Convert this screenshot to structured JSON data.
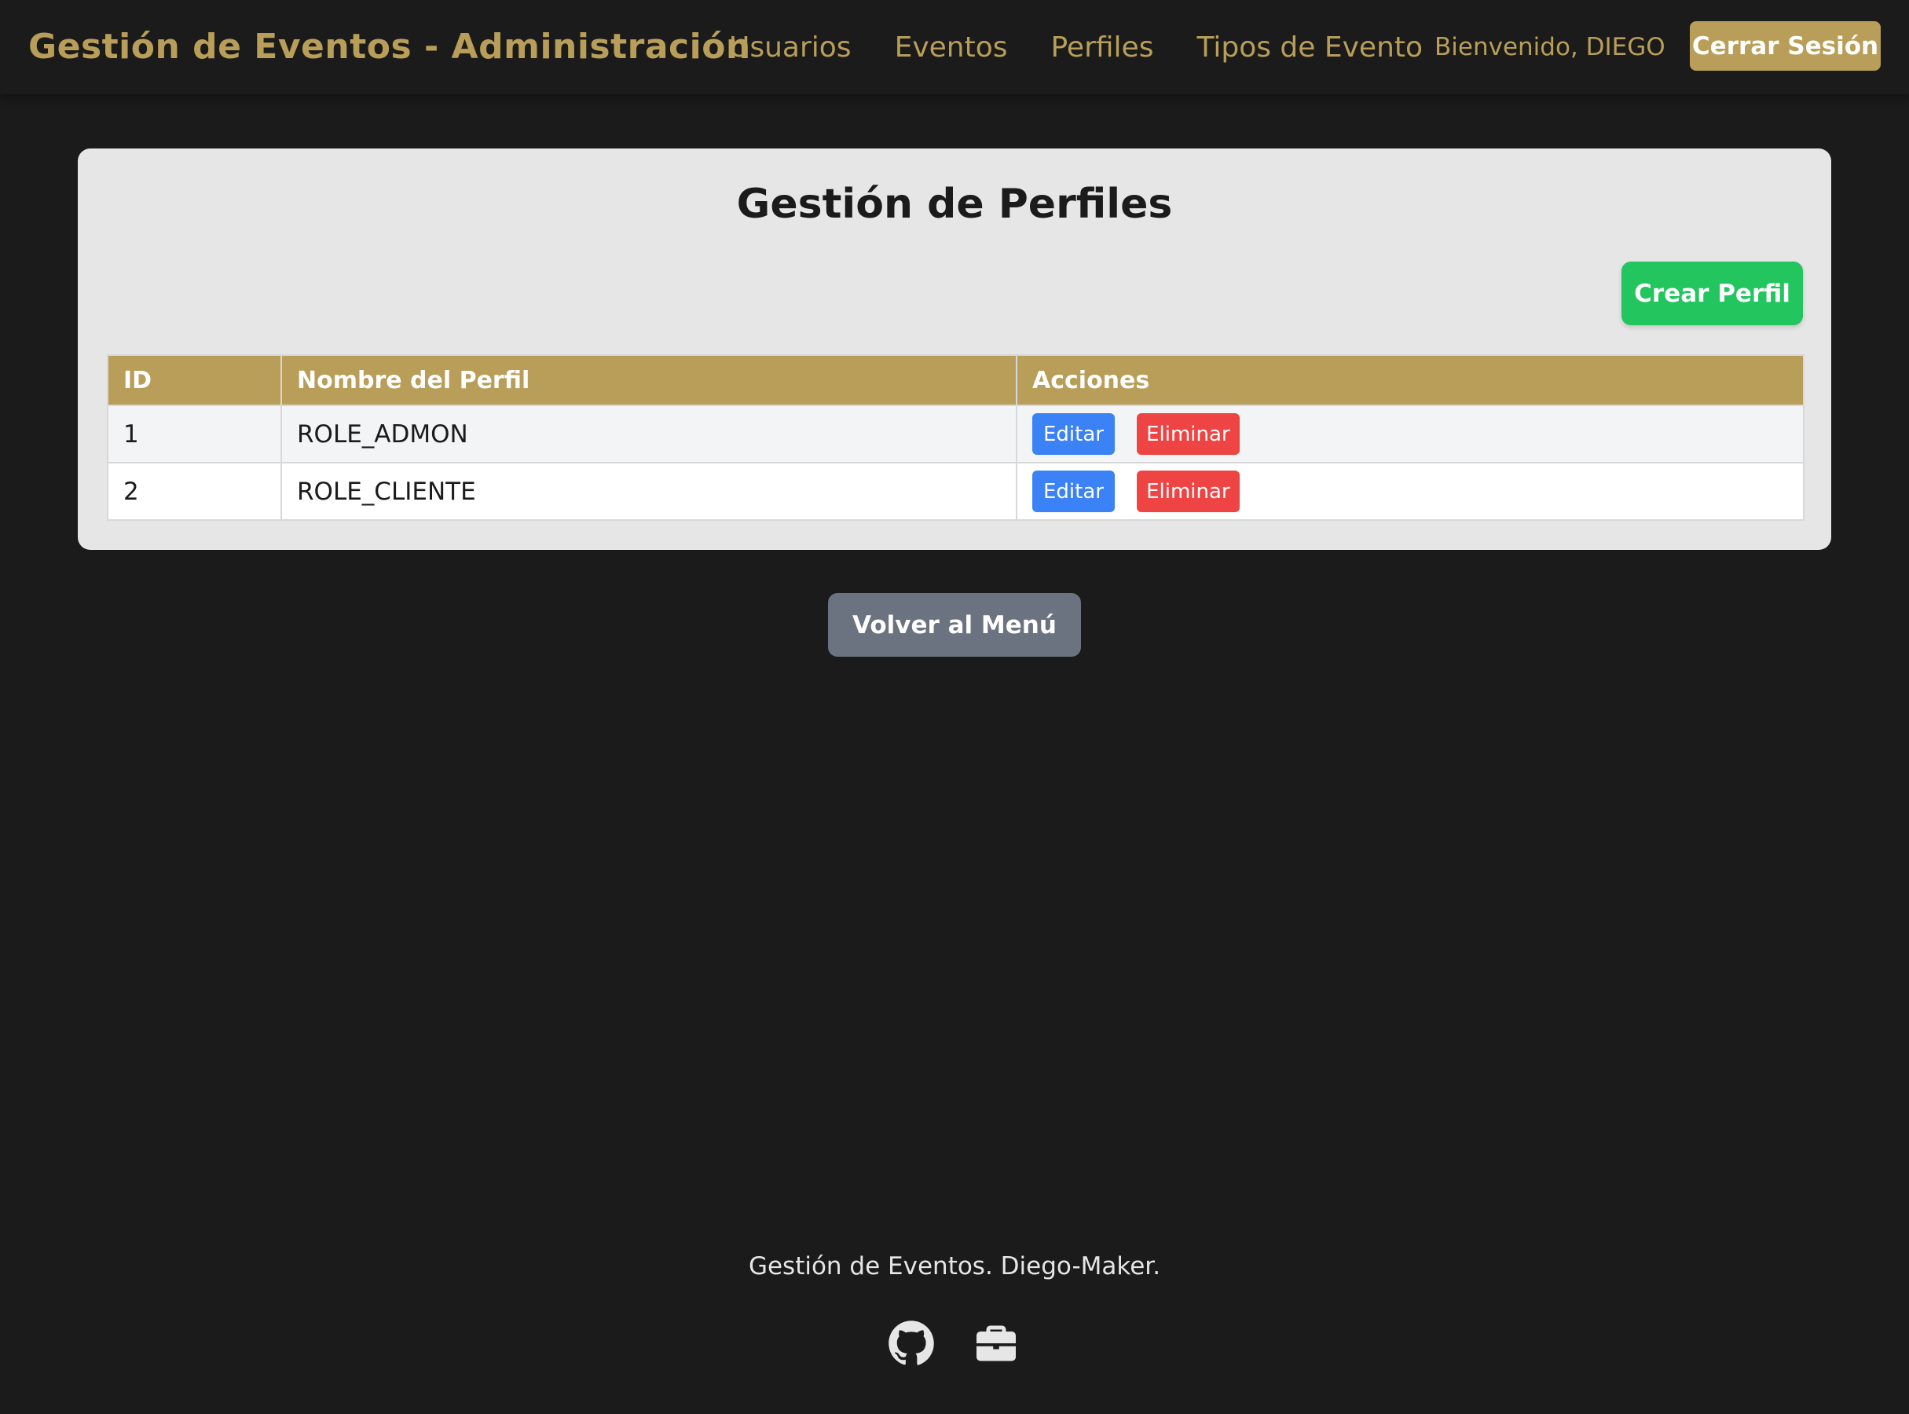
{
  "header": {
    "brand": "Gestión de Eventos - Administración",
    "nav": [
      {
        "label": "Usuarios"
      },
      {
        "label": "Eventos"
      },
      {
        "label": "Perfiles"
      },
      {
        "label": "Tipos de Evento"
      }
    ],
    "welcome": "Bienvenido, DIEGO",
    "separator": "|",
    "logout_label": "Cerrar Sesión"
  },
  "main": {
    "title": "Gestión de Perfiles",
    "create_label": "Crear Perfil",
    "table": {
      "columns": [
        "ID",
        "Nombre del Perfil",
        "Acciones"
      ],
      "rows": [
        {
          "id": "1",
          "name": "ROLE_ADMON",
          "edit": "Editar",
          "delete": "Eliminar"
        },
        {
          "id": "2",
          "name": "ROLE_CLIENTE",
          "edit": "Editar",
          "delete": "Eliminar"
        }
      ]
    },
    "back_label": "Volver al Menú"
  },
  "footer": {
    "text": "Gestión de Eventos. Diego-Maker.",
    "icons": [
      "github-icon",
      "briefcase-icon"
    ]
  },
  "colors": {
    "background": "#1b1b1b",
    "gold": "#b89e58",
    "green": "#22c55e",
    "blue": "#3b82f6",
    "red": "#ef4444",
    "gray": "#6b7280"
  }
}
